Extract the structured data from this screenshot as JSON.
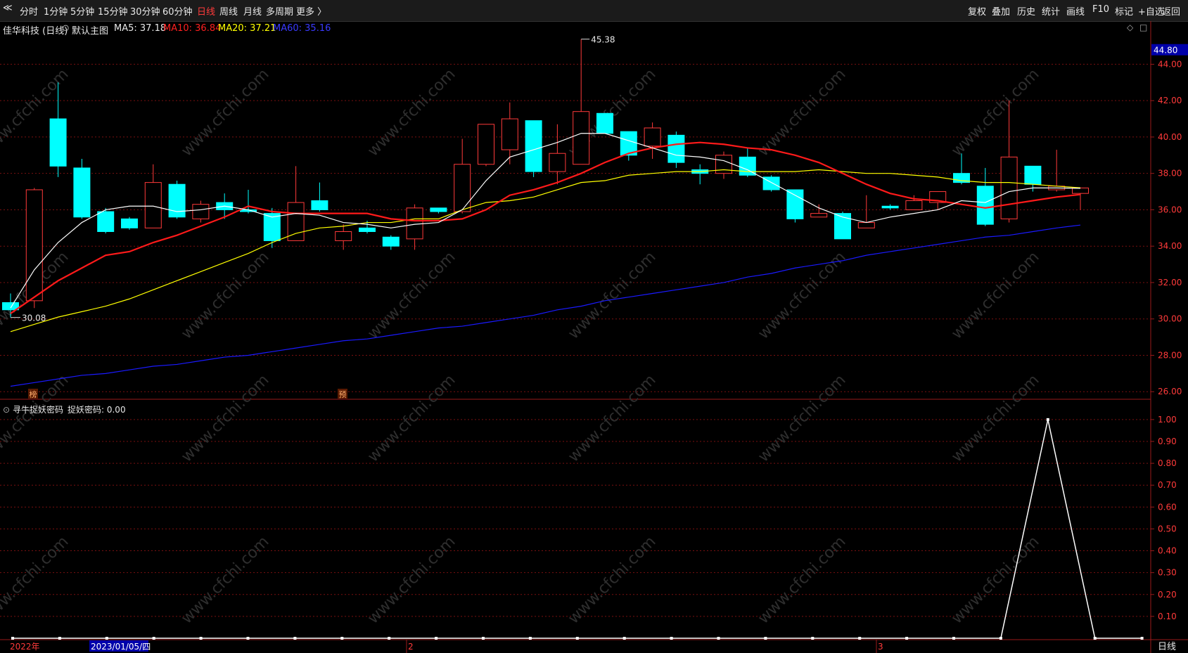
{
  "toolbar": {
    "left": [
      "分时",
      "1分钟",
      "5分钟",
      "15分钟",
      "30分钟",
      "60分钟",
      "日线",
      "周线",
      "月线",
      "多周期",
      "更多 〉"
    ],
    "active": "日线",
    "right": [
      "复权",
      "叠加",
      "历史",
      "统计",
      "画线",
      "F10",
      "标记",
      "+自选",
      "返回"
    ]
  },
  "legend": {
    "stock": "佳华科技 (日线)",
    "template": "默认主图",
    "ma5": "MA5: 37.18",
    "ma10": "MA10: 36.84",
    "ma20": "MA20: 37.21",
    "ma60": "MA60: 35.16"
  },
  "colors": {
    "up": "#ff3a3a",
    "down": "#00ffff",
    "ma5": "#ffffff",
    "ma10": "#ff1a1a",
    "ma20": "#ffff00",
    "ma60": "#1a1aff",
    "grid": "#7a1010",
    "accent": "#0000aa"
  },
  "price_axis": {
    "ticks": [
      "44.00",
      "42.00",
      "40.00",
      "38.00",
      "36.00",
      "34.00",
      "32.00",
      "30.00",
      "28.00",
      "26.00"
    ],
    "current": "44.80"
  },
  "annotations": {
    "high": "45.38",
    "low": "30.08",
    "marker1": "榜",
    "marker2": "预"
  },
  "indicator": {
    "title": "寻牛捉妖密码",
    "value_label": "捉妖密码: 0.00",
    "ticks": [
      "1.00",
      "0.90",
      "0.80",
      "0.70",
      "0.60",
      "0.50",
      "0.40",
      "0.30",
      "0.20",
      "0.10"
    ]
  },
  "date_axis": {
    "year": "2022年",
    "cursor_date": "2023/01/05/四",
    "month2": "2",
    "month3": "3"
  },
  "period_label": "日线",
  "watermark": "www.cfchi.com",
  "chart_data": {
    "type": "candlestick",
    "candles": [
      {
        "o": 30.9,
        "h": 31.4,
        "l": 30.08,
        "c": 30.5
      },
      {
        "o": 31.0,
        "h": 37.2,
        "l": 30.6,
        "c": 37.1
      },
      {
        "o": 41.0,
        "h": 43.0,
        "l": 37.8,
        "c": 38.4
      },
      {
        "o": 38.3,
        "h": 38.8,
        "l": 35.5,
        "c": 35.6
      },
      {
        "o": 35.9,
        "h": 36.1,
        "l": 34.7,
        "c": 34.8
      },
      {
        "o": 35.5,
        "h": 35.6,
        "l": 34.9,
        "c": 35.0
      },
      {
        "o": 35.0,
        "h": 38.5,
        "l": 35.0,
        "c": 37.5
      },
      {
        "o": 37.4,
        "h": 37.6,
        "l": 35.5,
        "c": 35.6
      },
      {
        "o": 35.5,
        "h": 36.5,
        "l": 35.3,
        "c": 36.3
      },
      {
        "o": 36.4,
        "h": 36.9,
        "l": 35.5,
        "c": 36.0
      },
      {
        "o": 36.0,
        "h": 37.1,
        "l": 35.8,
        "c": 35.9
      },
      {
        "o": 35.8,
        "h": 36.1,
        "l": 33.9,
        "c": 34.3
      },
      {
        "o": 34.3,
        "h": 38.4,
        "l": 34.3,
        "c": 36.4
      },
      {
        "o": 36.5,
        "h": 37.5,
        "l": 35.9,
        "c": 36.0
      },
      {
        "o": 34.3,
        "h": 35.2,
        "l": 33.8,
        "c": 34.8
      },
      {
        "o": 35.0,
        "h": 35.4,
        "l": 34.7,
        "c": 34.8
      },
      {
        "o": 34.5,
        "h": 34.6,
        "l": 33.8,
        "c": 34.0
      },
      {
        "o": 34.4,
        "h": 36.3,
        "l": 33.8,
        "c": 36.1
      },
      {
        "o": 36.1,
        "h": 36.1,
        "l": 35.8,
        "c": 35.9
      },
      {
        "o": 35.9,
        "h": 39.9,
        "l": 35.8,
        "c": 38.5
      },
      {
        "o": 38.5,
        "h": 40.6,
        "l": 38.4,
        "c": 40.7
      },
      {
        "o": 39.3,
        "h": 41.9,
        "l": 38.5,
        "c": 41.0
      },
      {
        "o": 40.9,
        "h": 40.9,
        "l": 37.8,
        "c": 38.1
      },
      {
        "o": 38.1,
        "h": 40.7,
        "l": 37.4,
        "c": 39.1
      },
      {
        "o": 38.5,
        "h": 45.38,
        "l": 38.5,
        "c": 41.4
      },
      {
        "o": 41.3,
        "h": 41.3,
        "l": 40.2,
        "c": 40.2
      },
      {
        "o": 40.3,
        "h": 40.3,
        "l": 38.7,
        "c": 39.0
      },
      {
        "o": 39.5,
        "h": 40.8,
        "l": 38.8,
        "c": 40.5
      },
      {
        "o": 40.1,
        "h": 40.3,
        "l": 38.3,
        "c": 38.6
      },
      {
        "o": 38.2,
        "h": 38.5,
        "l": 37.4,
        "c": 38.0
      },
      {
        "o": 38.0,
        "h": 39.2,
        "l": 37.7,
        "c": 39.0
      },
      {
        "o": 38.9,
        "h": 39.4,
        "l": 37.8,
        "c": 37.9
      },
      {
        "o": 37.8,
        "h": 37.9,
        "l": 37.0,
        "c": 37.1
      },
      {
        "o": 37.1,
        "h": 37.1,
        "l": 35.3,
        "c": 35.5
      },
      {
        "o": 35.6,
        "h": 36.3,
        "l": 35.6,
        "c": 35.8
      },
      {
        "o": 35.8,
        "h": 35.9,
        "l": 34.4,
        "c": 34.4
      },
      {
        "o": 35.0,
        "h": 36.8,
        "l": 35.0,
        "c": 35.3
      },
      {
        "o": 36.2,
        "h": 36.3,
        "l": 36.0,
        "c": 36.1
      },
      {
        "o": 36.0,
        "h": 36.8,
        "l": 36.0,
        "c": 36.5
      },
      {
        "o": 36.4,
        "h": 37.0,
        "l": 36.0,
        "c": 37.0
      },
      {
        "o": 38.0,
        "h": 39.1,
        "l": 37.4,
        "c": 37.5
      },
      {
        "o": 37.3,
        "h": 38.3,
        "l": 35.1,
        "c": 35.2
      },
      {
        "o": 35.5,
        "h": 42.0,
        "l": 35.3,
        "c": 38.9
      },
      {
        "o": 38.4,
        "h": 38.4,
        "l": 37.0,
        "c": 37.4
      },
      {
        "o": 37.1,
        "h": 39.3,
        "l": 37.0,
        "c": 37.3
      },
      {
        "o": 36.9,
        "h": 37.1,
        "l": 36.0,
        "c": 37.2
      }
    ],
    "ma5": [
      30.6,
      32.7,
      34.2,
      35.3,
      36.0,
      36.2,
      36.2,
      35.9,
      36.0,
      36.2,
      36.0,
      35.6,
      35.8,
      35.7,
      35.3,
      35.2,
      35.0,
      35.2,
      35.3,
      36.0,
      37.6,
      38.9,
      39.3,
      39.7,
      40.2,
      40.2,
      39.8,
      39.4,
      39.0,
      38.9,
      38.7,
      38.2,
      37.5,
      36.8,
      36.1,
      35.6,
      35.3,
      35.6,
      35.8,
      36.0,
      36.5,
      36.4,
      37.0,
      37.2,
      37.2,
      37.18
    ],
    "ma10": [
      30.3,
      31.2,
      32.1,
      32.8,
      33.5,
      33.7,
      34.2,
      34.6,
      35.1,
      35.6,
      36.2,
      35.9,
      35.8,
      35.8,
      35.8,
      35.8,
      35.5,
      35.4,
      35.4,
      35.5,
      36.0,
      36.8,
      37.1,
      37.5,
      38.0,
      38.6,
      39.1,
      39.4,
      39.6,
      39.7,
      39.6,
      39.4,
      39.3,
      39.0,
      38.6,
      38.0,
      37.4,
      36.9,
      36.6,
      36.5,
      36.3,
      36.1,
      36.3,
      36.5,
      36.7,
      36.84
    ],
    "ma20": [
      29.3,
      29.7,
      30.1,
      30.4,
      30.7,
      31.1,
      31.6,
      32.1,
      32.6,
      33.1,
      33.6,
      34.2,
      34.7,
      35.0,
      35.1,
      35.3,
      35.3,
      35.5,
      35.5,
      36.0,
      36.4,
      36.5,
      36.7,
      37.1,
      37.5,
      37.6,
      37.9,
      38.0,
      38.1,
      38.1,
      38.2,
      38.1,
      38.1,
      38.1,
      38.2,
      38.1,
      38.0,
      38.0,
      37.9,
      37.8,
      37.6,
      37.5,
      37.5,
      37.4,
      37.3,
      37.21
    ],
    "ma60": [
      26.3,
      26.5,
      26.7,
      26.9,
      27.0,
      27.2,
      27.4,
      27.5,
      27.7,
      27.9,
      28.0,
      28.2,
      28.4,
      28.6,
      28.8,
      28.9,
      29.1,
      29.3,
      29.5,
      29.6,
      29.8,
      30.0,
      30.2,
      30.5,
      30.7,
      31.0,
      31.2,
      31.4,
      31.6,
      31.8,
      32.0,
      32.3,
      32.5,
      32.8,
      33.0,
      33.2,
      33.5,
      33.7,
      33.9,
      34.1,
      34.3,
      34.5,
      34.6,
      34.8,
      35.0,
      35.16
    ],
    "indicator_values": [
      0,
      0,
      0,
      0,
      0,
      0,
      0,
      0,
      0,
      0,
      0,
      0,
      0,
      0,
      0,
      0,
      0,
      0,
      0,
      0,
      0,
      0,
      1,
      0,
      0
    ],
    "y_range": [
      25.7,
      45.6
    ],
    "indicator_range": [
      0,
      1.08
    ]
  }
}
